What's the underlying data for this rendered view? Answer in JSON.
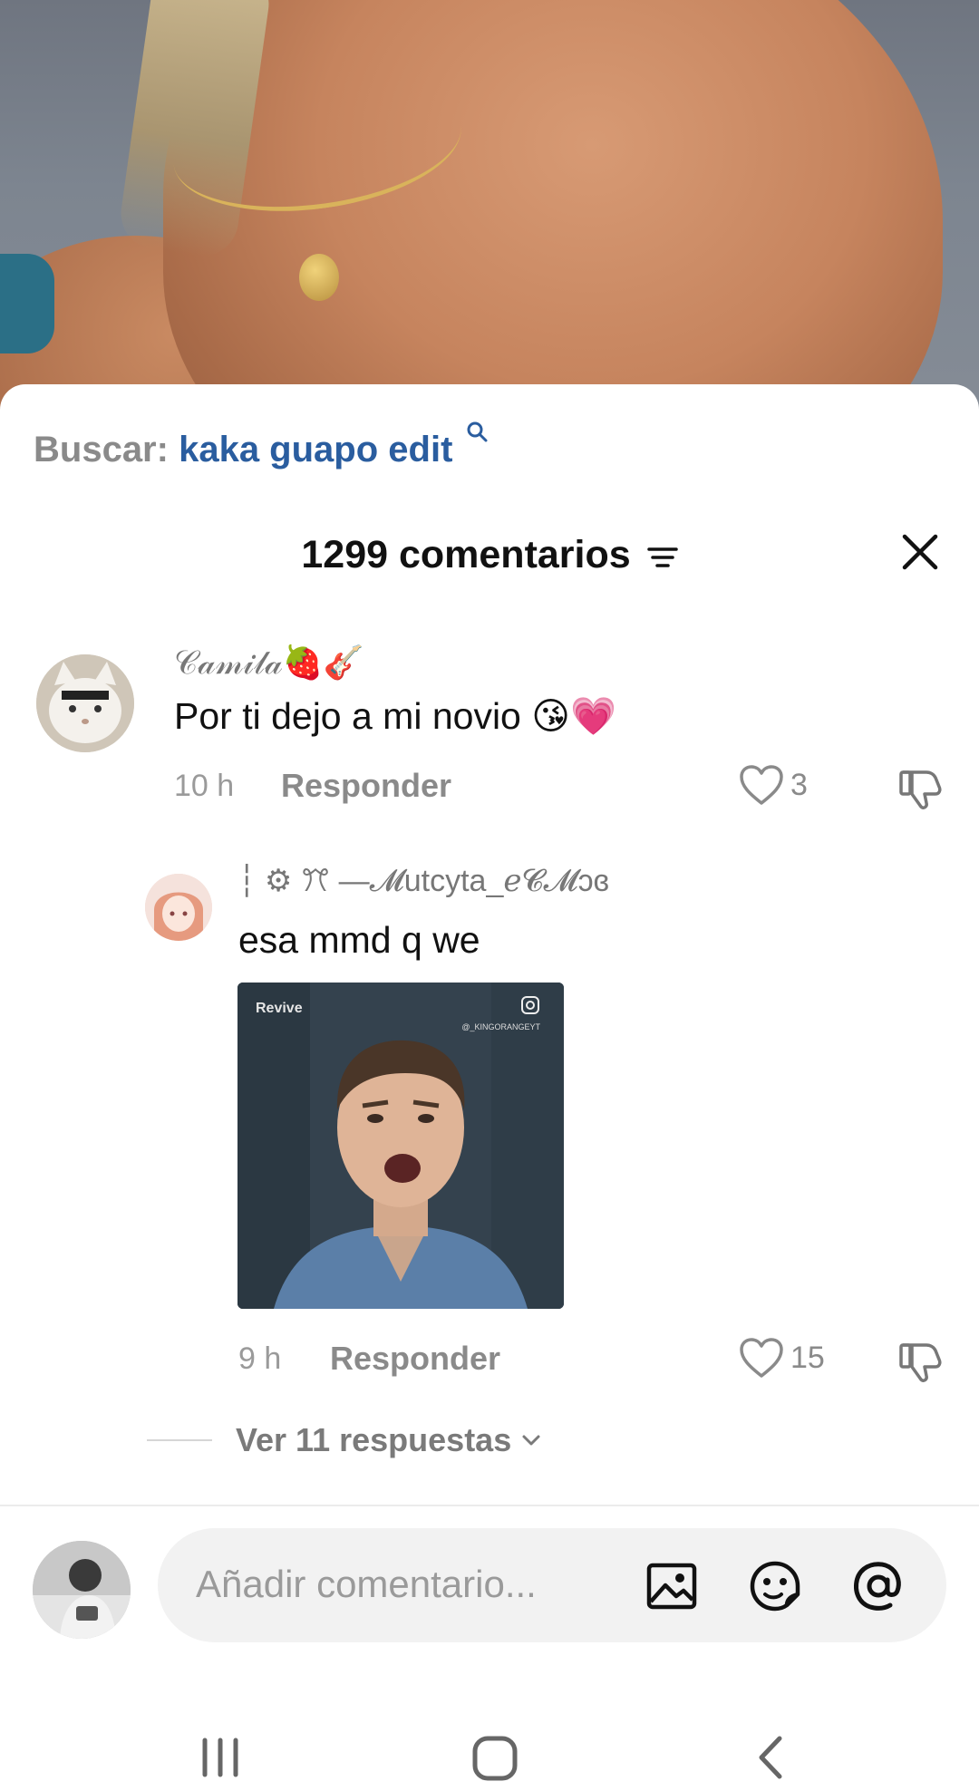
{
  "search": {
    "prefix": "Buscar:",
    "query": "kaka guapo edit"
  },
  "comments_header": {
    "count_label": "1299 comentarios"
  },
  "comments": [
    {
      "username": "𝒞𝒶𝓂𝒾𝓁𝒶🍓🎸",
      "text": "Por ti dejo a mi novio 😘💗",
      "time": "10 h",
      "reply_label": "Responder",
      "likes": "3"
    },
    {
      "username": "┆ ⚙︎ ꔫ —𝓜utcyta_ℯ𝓒𝓜ɔɞ",
      "text": "esa mmd q we",
      "time": "9 h",
      "reply_label": "Responder",
      "likes": "15",
      "gif": {
        "brand": "Revive",
        "handle": "@_KINGORANGEYT"
      }
    }
  ],
  "replies": {
    "label": "Ver 11 respuestas"
  },
  "composer": {
    "placeholder": "Añadir comentario..."
  },
  "icons": {
    "filter": "filter-icon",
    "close": "close-icon",
    "like": "heart-icon",
    "dislike": "thumbs-down-icon",
    "image": "image-icon",
    "emoji": "emoji-icon",
    "mention": "at-icon"
  },
  "colors": {
    "search_query": "#2a5d9f",
    "muted": "#8a8a8a",
    "input_bg": "#f2f2f2"
  }
}
